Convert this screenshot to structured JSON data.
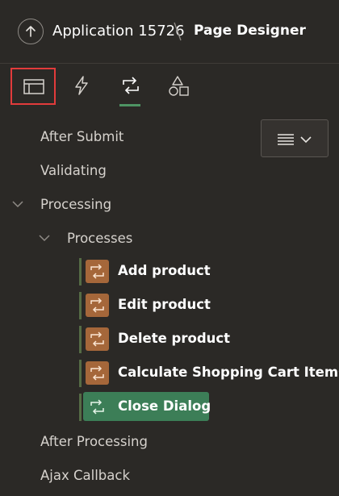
{
  "header": {
    "app_name": "Application 15726",
    "page_name": "Page Designer",
    "up_icon": "arrow-up-icon"
  },
  "tabs": [
    {
      "name": "rendering",
      "icon": "layout-icon",
      "highlighted": true,
      "active": false
    },
    {
      "name": "dynamic-actions",
      "icon": "lightning-icon",
      "highlighted": false,
      "active": false
    },
    {
      "name": "processing",
      "icon": "refresh-loop-icon",
      "highlighted": false,
      "active": true
    },
    {
      "name": "shared-components",
      "icon": "shapes-icon",
      "highlighted": false,
      "active": false
    }
  ],
  "menu_button": {
    "icon": "hamburger-menu-icon",
    "chevron": "chevron-down-icon"
  },
  "tree": {
    "after_submit": "After Submit",
    "validating": "Validating",
    "processing": "Processing",
    "processes": "Processes",
    "items": [
      {
        "label": "Add product",
        "selected": false
      },
      {
        "label": "Edit product",
        "selected": false
      },
      {
        "label": "Delete product",
        "selected": false
      },
      {
        "label": "Calculate Shopping Cart Items",
        "selected": false
      },
      {
        "label": "Close Dialog",
        "selected": true
      }
    ],
    "after_processing": "After Processing",
    "ajax_callback": "Ajax Callback"
  },
  "colors": {
    "background": "#2b2926",
    "process_icon": "#a5673a",
    "selected": "#3c7e57",
    "tab_highlight": "#e23b3b",
    "active_underline": "#4e9463"
  }
}
